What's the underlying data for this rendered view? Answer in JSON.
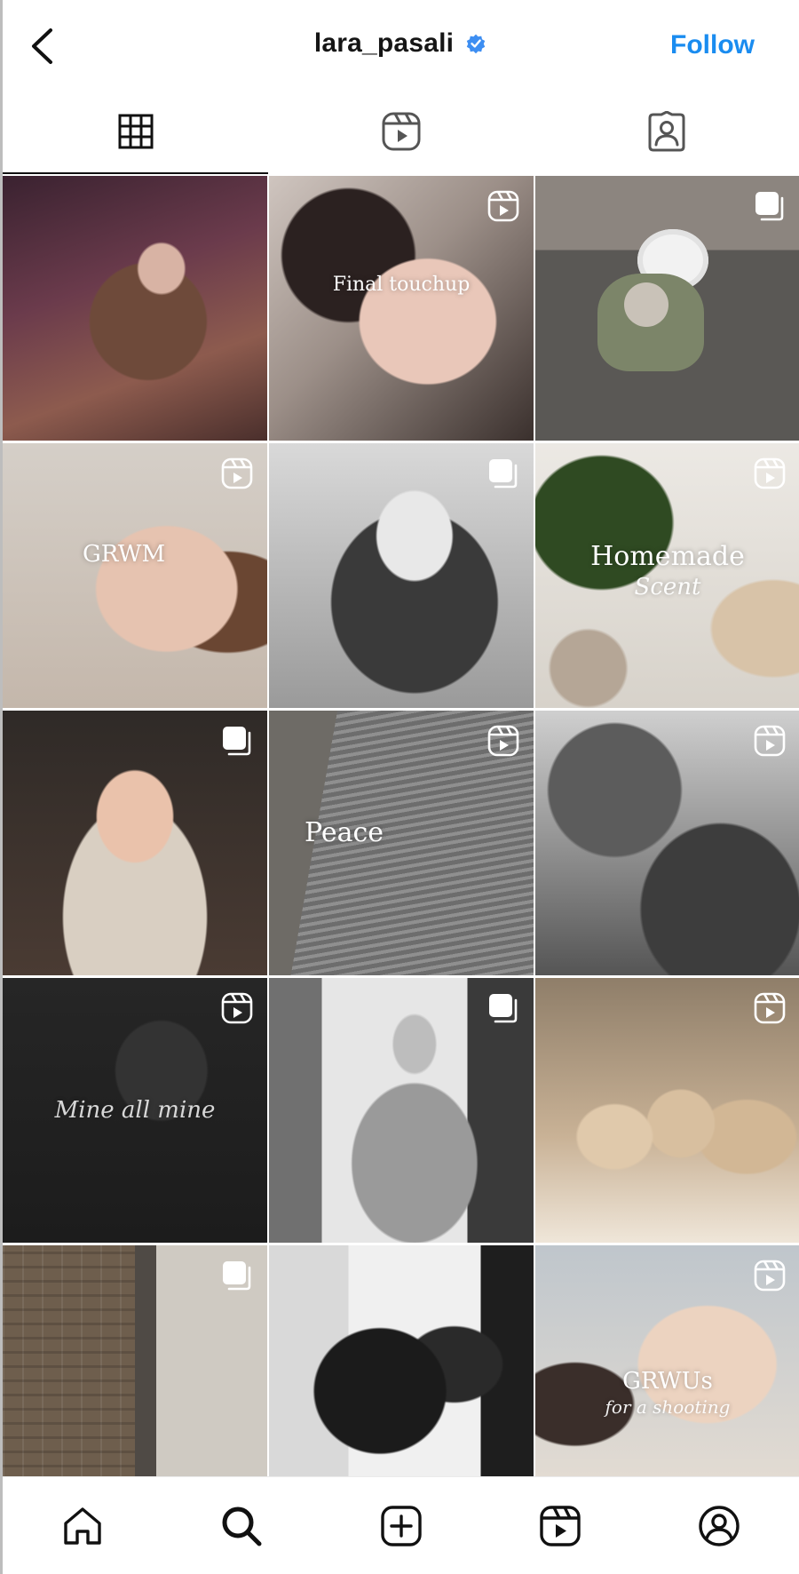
{
  "header": {
    "username": "lara_pasali",
    "verified": true,
    "follow_label": "Follow",
    "back_icon": "chevron-left-icon",
    "verified_icon": "verified-badge-icon",
    "accent_color": "#1a8cf0"
  },
  "tabs": [
    {
      "name": "posts-grid",
      "icon": "grid-icon",
      "active": true
    },
    {
      "name": "reels",
      "icon": "reels-icon",
      "active": false
    },
    {
      "name": "tagged",
      "icon": "tagged-person-icon",
      "active": false
    }
  ],
  "grid": [
    {
      "badge": null,
      "overlay": "",
      "overlay_sub": ""
    },
    {
      "badge": "reel",
      "overlay": "Final touchup",
      "overlay_sub": ""
    },
    {
      "badge": "carousel",
      "overlay": "",
      "overlay_sub": ""
    },
    {
      "badge": "reel",
      "overlay": "GRWM",
      "overlay_sub": ""
    },
    {
      "badge": "carousel",
      "overlay": "",
      "overlay_sub": ""
    },
    {
      "badge": "reel",
      "overlay": "Homemade",
      "overlay_sub": "Scent"
    },
    {
      "badge": "carousel",
      "overlay": "",
      "overlay_sub": ""
    },
    {
      "badge": "reel",
      "overlay": "Peace",
      "overlay_sub": ""
    },
    {
      "badge": "reel",
      "overlay": "",
      "overlay_sub": ""
    },
    {
      "badge": "reel",
      "overlay": "",
      "overlay_sub": "Mine all mine"
    },
    {
      "badge": "carousel",
      "overlay": "",
      "overlay_sub": ""
    },
    {
      "badge": "reel",
      "overlay": "",
      "overlay_sub": ""
    },
    {
      "badge": "carousel",
      "overlay": "",
      "overlay_sub": ""
    },
    {
      "badge": null,
      "overlay": "",
      "overlay_sub": ""
    },
    {
      "badge": "reel",
      "overlay": "GRWUs",
      "overlay_sub": "for a shooting"
    }
  ],
  "bottom_nav": [
    {
      "name": "home",
      "icon": "home-icon"
    },
    {
      "name": "search",
      "icon": "search-icon"
    },
    {
      "name": "create",
      "icon": "add-post-icon"
    },
    {
      "name": "reels",
      "icon": "reels-icon"
    },
    {
      "name": "profile",
      "icon": "profile-icon"
    }
  ]
}
